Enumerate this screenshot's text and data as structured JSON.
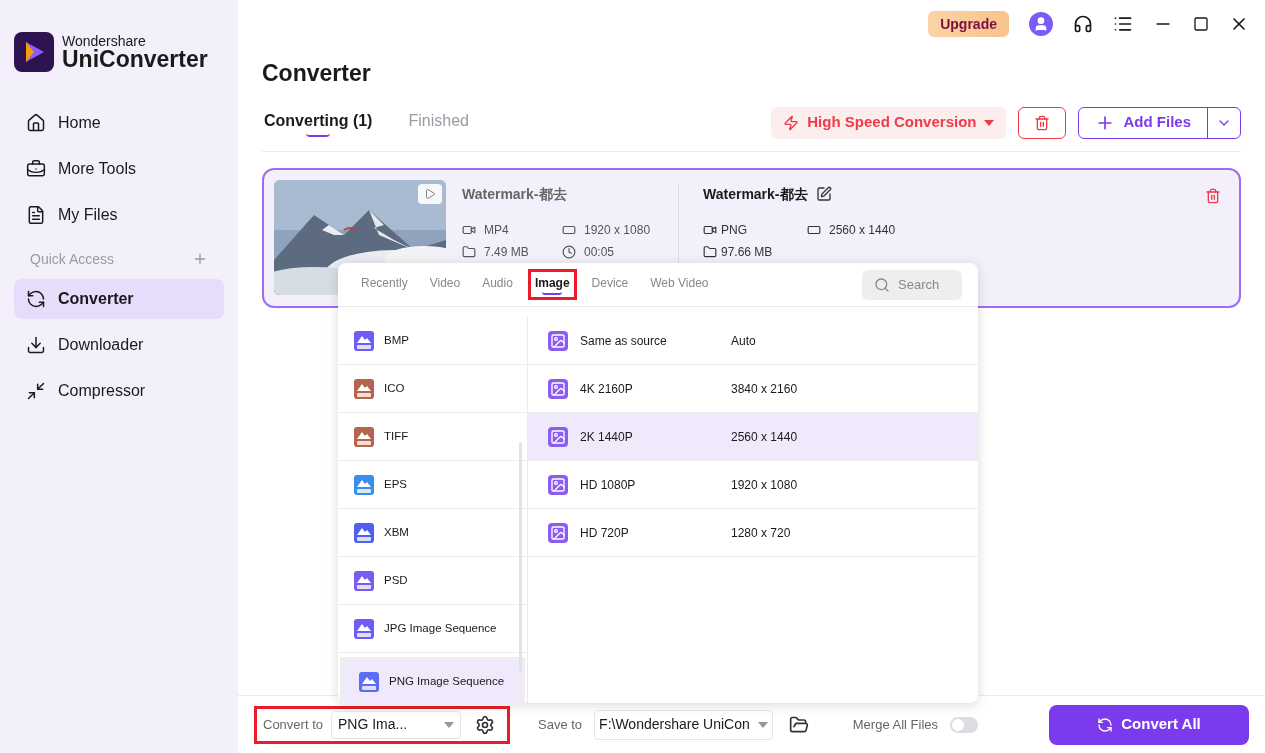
{
  "app": {
    "brand_top": "Wondershare",
    "brand_name": "UniConverter"
  },
  "sidebar": {
    "items": [
      {
        "kind": "item",
        "label": "Home",
        "selected": false
      },
      {
        "kind": "item",
        "label": "More Tools",
        "selected": false
      },
      {
        "kind": "item",
        "label": "My Files",
        "selected": false
      },
      {
        "kind": "header",
        "label": "Quick Access"
      },
      {
        "kind": "item",
        "label": "Converter",
        "selected": true
      },
      {
        "kind": "item",
        "label": "Downloader",
        "selected": false
      },
      {
        "kind": "item",
        "label": "Compressor",
        "selected": false
      }
    ]
  },
  "topbar": {
    "upgrade": "Upgrade"
  },
  "page": {
    "title": "Converter",
    "tabs": [
      {
        "label": "Converting (1)",
        "selected": true
      },
      {
        "label": "Finished",
        "selected": false
      }
    ],
    "high_speed": "High Speed Conversion",
    "add_files": "Add Files"
  },
  "file": {
    "source": {
      "name": "Watermark-都去",
      "format": "MP4",
      "resolution": "1920 x 1080",
      "size": "7.49 MB",
      "duration": "00:05"
    },
    "target": {
      "name": "Watermark-都去",
      "format": "PNG",
      "resolution": "2560 x 1440",
      "size": "97.66 MB"
    }
  },
  "format_menu": {
    "tabs": [
      {
        "label": "Recently",
        "selected": false,
        "highlighted": false
      },
      {
        "label": "Video",
        "selected": false,
        "highlighted": false
      },
      {
        "label": "Audio",
        "selected": false,
        "highlighted": false
      },
      {
        "label": "Image",
        "selected": true,
        "highlighted": true
      },
      {
        "label": "Device",
        "selected": false,
        "highlighted": false
      },
      {
        "label": "Web Video",
        "selected": false,
        "highlighted": false
      }
    ],
    "search_placeholder": "Search",
    "formats": [
      {
        "label": "BMP",
        "color": "#6d5cf5",
        "selected": false,
        "highlighted": false
      },
      {
        "label": "ICO",
        "color": "#b5654c",
        "selected": false,
        "highlighted": false
      },
      {
        "label": "TIFF",
        "color": "#b5654c",
        "selected": false,
        "highlighted": false
      },
      {
        "label": "EPS",
        "color": "#3b8df0",
        "selected": false,
        "highlighted": false
      },
      {
        "label": "XBM",
        "color": "#4f5ff0",
        "selected": false,
        "highlighted": false
      },
      {
        "label": "PSD",
        "color": "#7a5cf0",
        "selected": false,
        "highlighted": false
      },
      {
        "label": "JPG Image Sequence",
        "color": "#6d5cf5",
        "selected": false,
        "highlighted": false
      },
      {
        "label": "PNG Image Sequence",
        "color": "#5b6cf5",
        "selected": true,
        "highlighted": true
      }
    ],
    "presets": [
      {
        "name": "Same as source",
        "resolution": "Auto",
        "selected": false
      },
      {
        "name": "4K 2160P",
        "resolution": "3840 x 2160",
        "selected": false
      },
      {
        "name": "2K 1440P",
        "resolution": "2560 x 1440",
        "selected": true
      },
      {
        "name": "HD 1080P",
        "resolution": "1920 x 1080",
        "selected": false
      },
      {
        "name": "HD 720P",
        "resolution": "1280 x 720",
        "selected": false
      }
    ]
  },
  "bottom": {
    "convert_to_label": "Convert to",
    "convert_to_value": "PNG Ima...",
    "highlighted": true,
    "save_to_label": "Save to",
    "save_to_value": "F:\\Wondershare UniCon",
    "merge_label": "Merge All Files",
    "merge_on": false,
    "convert_all": "Convert All"
  }
}
